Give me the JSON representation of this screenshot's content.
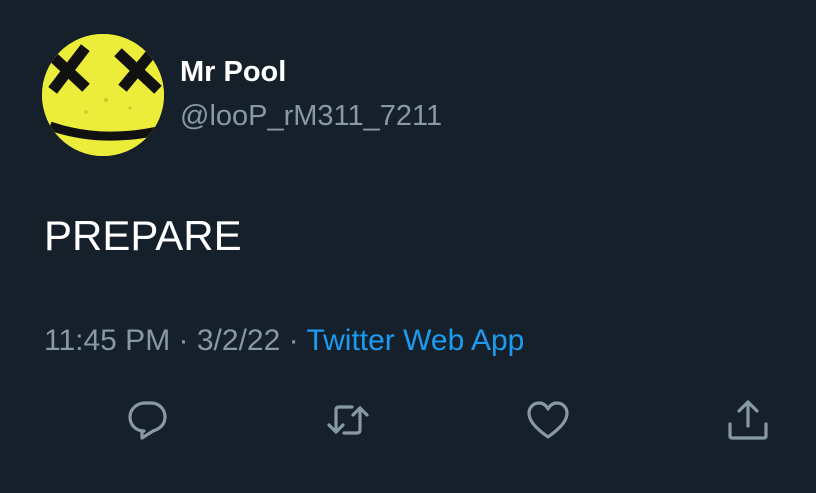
{
  "user": {
    "display_name": "Mr Pool",
    "handle": "@looP_rM311_7211",
    "avatar": "yellow-smiley-avatar"
  },
  "tweet": {
    "text": "PREPARE",
    "time": "11:45 PM",
    "date": "3/2/22",
    "separator": "·",
    "source": "Twitter Web App"
  },
  "actions": [
    {
      "icon": "reply-icon"
    },
    {
      "icon": "retweet-icon"
    },
    {
      "icon": "like-icon"
    },
    {
      "icon": "share-icon"
    }
  ],
  "colors": {
    "background": "#15202b",
    "primary_text": "#ffffff",
    "secondary_text": "#8899a6",
    "link": "#1d9bf0",
    "avatar_yellow": "#f0f03a"
  }
}
